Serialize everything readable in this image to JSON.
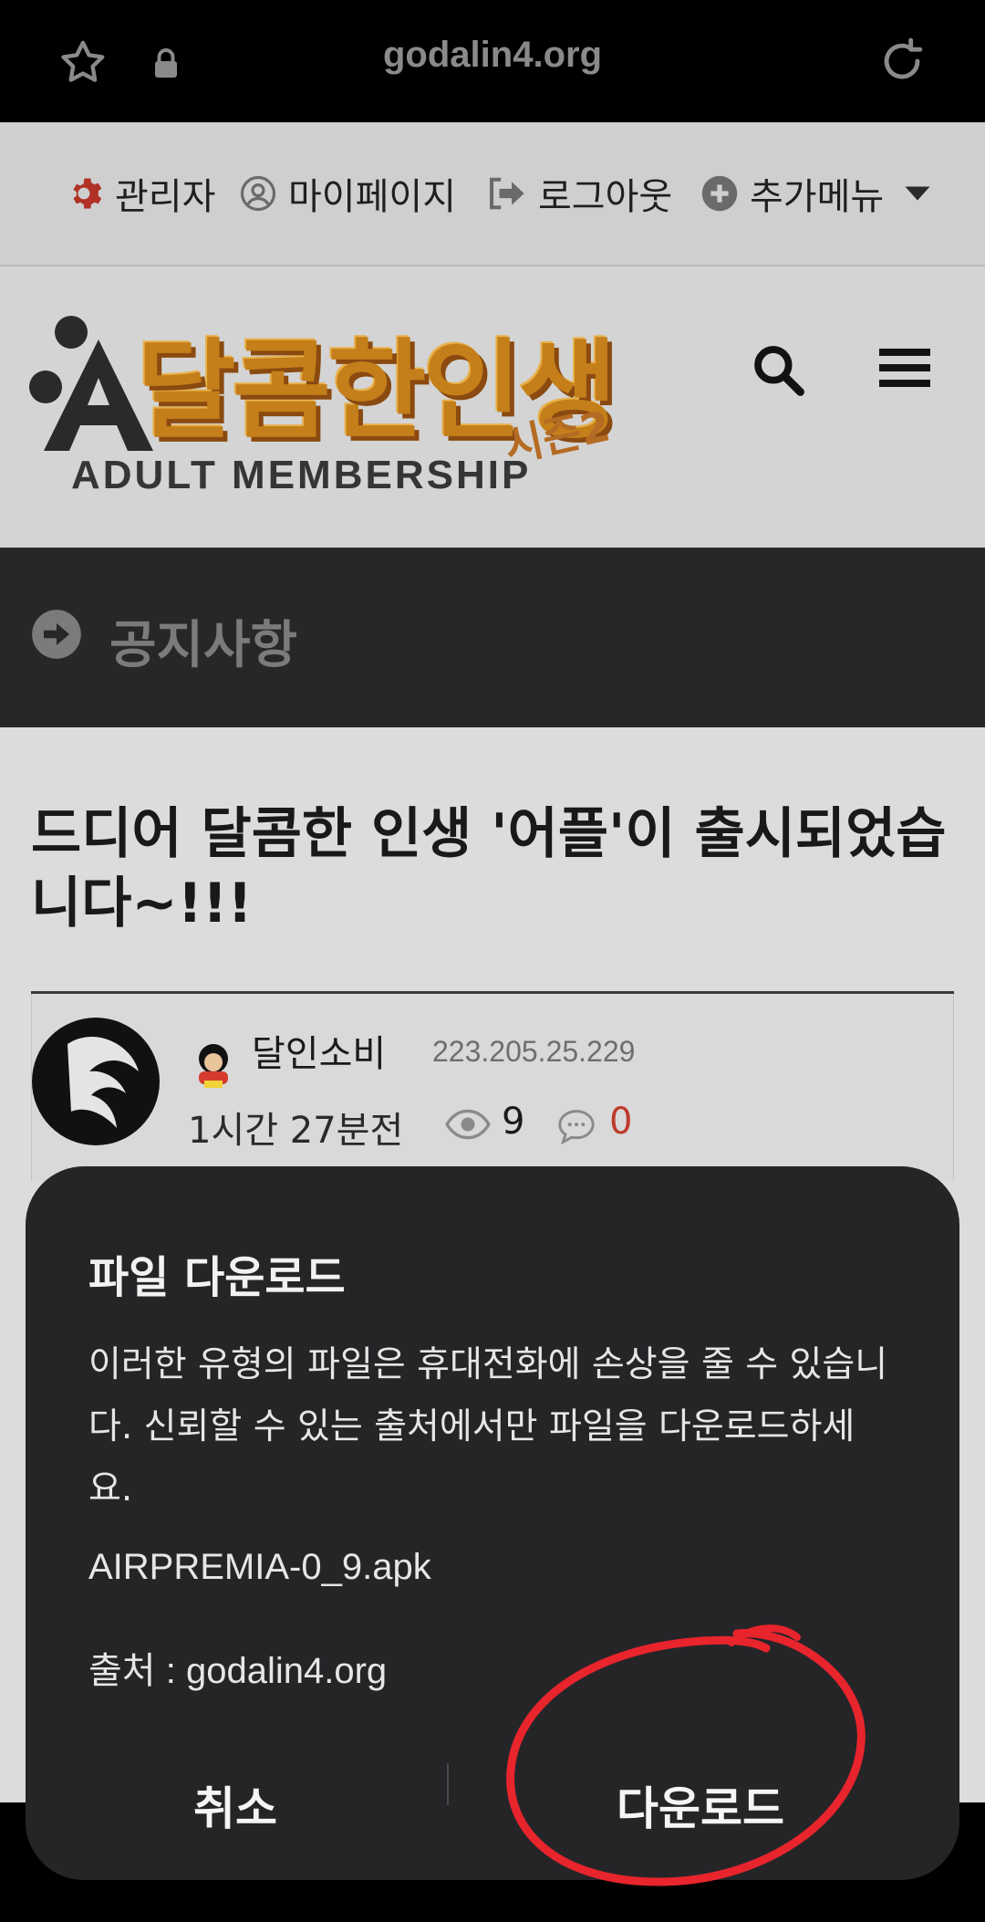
{
  "browser": {
    "url": "godalin4.org"
  },
  "admin_menu": {
    "items": [
      {
        "label": "관리자",
        "icon": "gear-icon"
      },
      {
        "label": "마이페이지",
        "icon": "user-circle-icon"
      },
      {
        "label": "로그아웃",
        "icon": "logout-icon"
      },
      {
        "label": "추가메뉴",
        "icon": "plus-circle-icon"
      }
    ]
  },
  "logo": {
    "title": "달콤한인생",
    "season": "시즌2",
    "subtitle": "ADULT MEMBERSHIP"
  },
  "section": {
    "label": "공지사항"
  },
  "post": {
    "title": "드디어 달콤한 인생 '어플'이 출시되었습니다~!!!",
    "author": "달인소비",
    "ip": "223.205.25.229",
    "time": "1시간 27분전",
    "views": "9",
    "comments": "0"
  },
  "dialog": {
    "title": "파일 다운로드",
    "message": "이러한 유형의 파일은 휴대전화에 손상을 줄 수 있습니다. 신뢰할 수 있는 출처에서만 파일을 다운로드하세요.",
    "filename": "AIRPREMIA-0_9.apk",
    "source_label": "출처",
    "source_sep": " : ",
    "source_value": "godalin4.org",
    "cancel_label": "취소",
    "download_label": "다운로드"
  },
  "colors": {
    "browser_bg": "#000000",
    "dialog_bg": "#252528",
    "notice_bg": "#272727",
    "annotation_red": "#e8242c",
    "comment_count": "#c0392b"
  }
}
